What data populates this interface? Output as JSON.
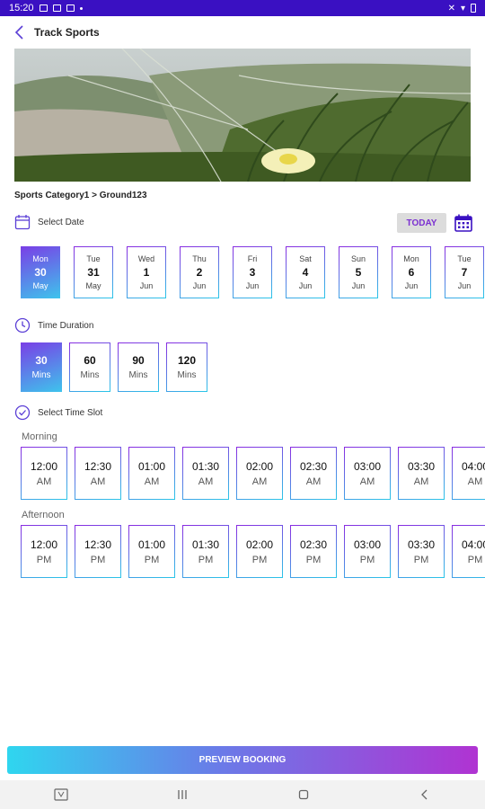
{
  "status_bar": {
    "time": "15:20"
  },
  "header": {
    "title": "Track Sports"
  },
  "breadcrumb": "Sports Category1 > Ground123",
  "select_date": {
    "label": "Select Date",
    "today_label": "TODAY",
    "dates": [
      {
        "day": "Mon",
        "date": "30",
        "month": "May",
        "selected": true
      },
      {
        "day": "Tue",
        "date": "31",
        "month": "May",
        "selected": false
      },
      {
        "day": "Wed",
        "date": "1",
        "month": "Jun",
        "selected": false
      },
      {
        "day": "Thu",
        "date": "2",
        "month": "Jun",
        "selected": false
      },
      {
        "day": "Fri",
        "date": "3",
        "month": "Jun",
        "selected": false
      },
      {
        "day": "Sat",
        "date": "4",
        "month": "Jun",
        "selected": false
      },
      {
        "day": "Sun",
        "date": "5",
        "month": "Jun",
        "selected": false
      },
      {
        "day": "Mon",
        "date": "6",
        "month": "Jun",
        "selected": false
      },
      {
        "day": "Tue",
        "date": "7",
        "month": "Jun",
        "selected": false
      }
    ]
  },
  "time_duration": {
    "label": "Time Duration",
    "options": [
      {
        "value": "30",
        "unit": "Mins",
        "selected": true
      },
      {
        "value": "60",
        "unit": "Mins",
        "selected": false
      },
      {
        "value": "90",
        "unit": "Mins",
        "selected": false
      },
      {
        "value": "120",
        "unit": "Mins",
        "selected": false
      }
    ]
  },
  "time_slot": {
    "label": "Select Time Slot",
    "morning_label": "Morning",
    "afternoon_label": "Afternoon",
    "morning": [
      {
        "time": "12:00",
        "period": "AM"
      },
      {
        "time": "12:30",
        "period": "AM"
      },
      {
        "time": "01:00",
        "period": "AM"
      },
      {
        "time": "01:30",
        "period": "AM"
      },
      {
        "time": "02:00",
        "period": "AM"
      },
      {
        "time": "02:30",
        "period": "AM"
      },
      {
        "time": "03:00",
        "period": "AM"
      },
      {
        "time": "03:30",
        "period": "AM"
      },
      {
        "time": "04:00",
        "period": "AM"
      }
    ],
    "afternoon": [
      {
        "time": "12:00",
        "period": "PM"
      },
      {
        "time": "12:30",
        "period": "PM"
      },
      {
        "time": "01:00",
        "period": "PM"
      },
      {
        "time": "01:30",
        "period": "PM"
      },
      {
        "time": "02:00",
        "period": "PM"
      },
      {
        "time": "02:30",
        "period": "PM"
      },
      {
        "time": "03:00",
        "period": "PM"
      },
      {
        "time": "03:30",
        "period": "PM"
      },
      {
        "time": "04:00",
        "period": "PM"
      }
    ]
  },
  "preview_button": "PREVIEW BOOKING",
  "colors": {
    "status_bar": "#3a10c2",
    "accent_purple": "#7b2fd1",
    "accent_cyan": "#29c7e8"
  }
}
